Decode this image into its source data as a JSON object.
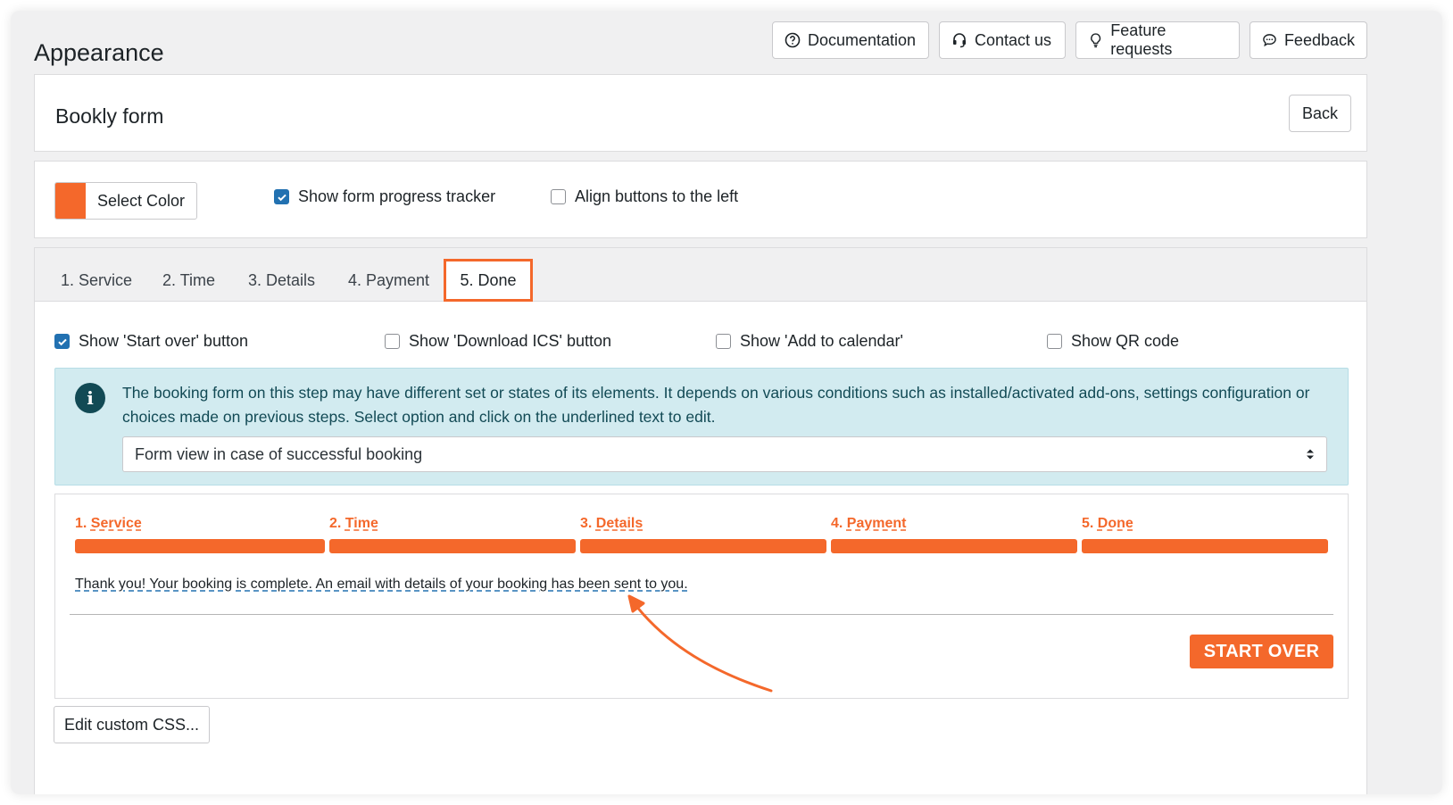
{
  "page_title": "Appearance",
  "header_buttons": [
    {
      "label": "Documentation",
      "icon": "question-circle-icon"
    },
    {
      "label": "Contact us",
      "icon": "headset-icon"
    },
    {
      "label": "Feature requests",
      "icon": "lightbulb-icon"
    },
    {
      "label": "Feedback",
      "icon": "chat-bubble-icon"
    }
  ],
  "form_card": {
    "title": "Bookly form",
    "back_label": "Back"
  },
  "settings": {
    "color_button_label": "Select Color",
    "selected_color": "#f4682b",
    "progress_tracker": {
      "label": "Show form progress tracker",
      "checked": true
    },
    "align_left": {
      "label": "Align buttons to the left",
      "checked": false
    }
  },
  "tabs": [
    {
      "label": "1. Service"
    },
    {
      "label": "2. Time"
    },
    {
      "label": "3. Details"
    },
    {
      "label": "4. Payment"
    },
    {
      "label": "5. Done",
      "active": true
    }
  ],
  "done_options": [
    {
      "label": "Show 'Start over' button",
      "checked": true
    },
    {
      "label": "Show 'Download ICS' button",
      "checked": false
    },
    {
      "label": "Show 'Add to calendar'",
      "checked": false
    },
    {
      "label": "Show QR code",
      "checked": false
    }
  ],
  "info": {
    "text": "The booking form on this step may have different set or states of its elements. It depends on various conditions such as installed/activated add-ons, settings configuration or choices made on previous steps. Select option and click on the underlined text to edit.",
    "select_value": "Form view in case of successful booking"
  },
  "preview": {
    "steps": [
      {
        "num": "1.",
        "label": "Service"
      },
      {
        "num": "2.",
        "label": "Time"
      },
      {
        "num": "3.",
        "label": "Details"
      },
      {
        "num": "4.",
        "label": "Payment"
      },
      {
        "num": "5.",
        "label": "Done"
      }
    ],
    "message": "Thank you! Your booking is complete. An email with details of your booking has been sent to you.",
    "start_over_label": "START OVER"
  },
  "custom_css_label": "Edit custom CSS...",
  "colors": {
    "accent": "#f4682b",
    "checkbox": "#2271b1",
    "info_bg": "#d2ebf0"
  }
}
